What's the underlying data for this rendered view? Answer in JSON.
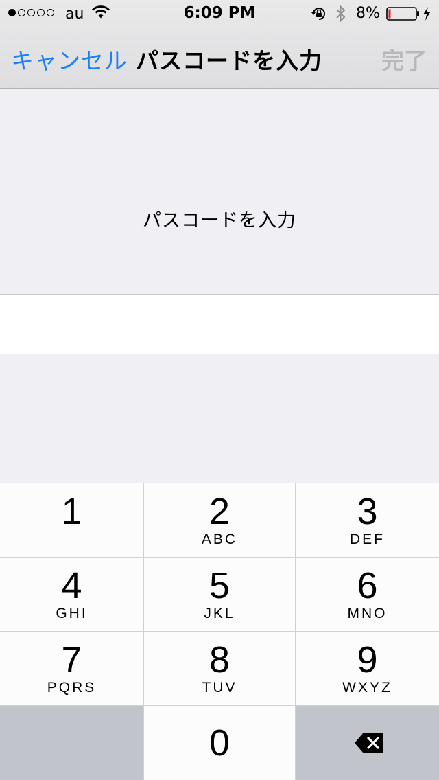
{
  "status_bar": {
    "carrier": "au",
    "time": "6:09 PM",
    "battery_percent": "8%",
    "battery_level": 0.08,
    "signal_bars_filled": 1,
    "signal_bars_total": 5,
    "icons": [
      "wifi-icon",
      "rotation-lock-icon",
      "bluetooth-icon",
      "battery-icon",
      "charging-bolt-icon"
    ]
  },
  "nav": {
    "cancel_label": "キャンセル",
    "title": "パスコードを入力",
    "done_label": "完了"
  },
  "content": {
    "prompt": "パスコードを入力",
    "passcode_value": ""
  },
  "keypad": {
    "keys": [
      {
        "digit": "1",
        "letters": ""
      },
      {
        "digit": "2",
        "letters": "ABC"
      },
      {
        "digit": "3",
        "letters": "DEF"
      },
      {
        "digit": "4",
        "letters": "GHI"
      },
      {
        "digit": "5",
        "letters": "JKL"
      },
      {
        "digit": "6",
        "letters": "MNO"
      },
      {
        "digit": "7",
        "letters": "PQRS"
      },
      {
        "digit": "8",
        "letters": "TUV"
      },
      {
        "digit": "9",
        "letters": "WXYZ"
      },
      {
        "digit": "0",
        "letters": ""
      }
    ],
    "delete_icon": "backspace-icon"
  },
  "colors": {
    "accent": "#1a80fa",
    "disabled": "#b8b8bc",
    "battery_low": "#e0242a",
    "background": "#efeff4"
  }
}
